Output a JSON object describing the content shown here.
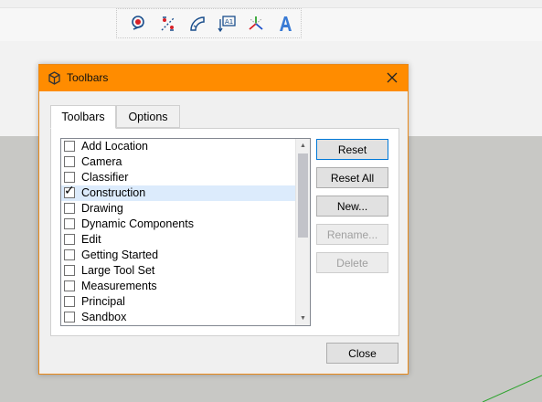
{
  "app": {
    "toolbar_icons": [
      "position-camera-icon",
      "walk-icon",
      "protractor-icon",
      "text-label-icon",
      "axes-icon",
      "3d-text-icon"
    ],
    "viewport_line_color": "#2ea32e"
  },
  "dialog": {
    "title": "Toolbars",
    "accent_color": "#ff8c00",
    "tabs": [
      {
        "label": "Toolbars",
        "active": true
      },
      {
        "label": "Options",
        "active": false
      }
    ],
    "items": [
      {
        "label": "Add Location",
        "checked": false,
        "selected": false
      },
      {
        "label": "Camera",
        "checked": false,
        "selected": false
      },
      {
        "label": "Classifier",
        "checked": false,
        "selected": false
      },
      {
        "label": "Construction",
        "checked": true,
        "selected": true
      },
      {
        "label": "Drawing",
        "checked": false,
        "selected": false
      },
      {
        "label": "Dynamic Components",
        "checked": false,
        "selected": false
      },
      {
        "label": "Edit",
        "checked": false,
        "selected": false
      },
      {
        "label": "Getting Started",
        "checked": false,
        "selected": false
      },
      {
        "label": "Large Tool Set",
        "checked": false,
        "selected": false
      },
      {
        "label": "Measurements",
        "checked": false,
        "selected": false
      },
      {
        "label": "Principal",
        "checked": false,
        "selected": false
      },
      {
        "label": "Sandbox",
        "checked": false,
        "selected": false
      }
    ],
    "buttons": {
      "reset": "Reset",
      "reset_all": "Reset All",
      "new": "New...",
      "rename": "Rename...",
      "delete": "Delete",
      "close": "Close"
    }
  }
}
